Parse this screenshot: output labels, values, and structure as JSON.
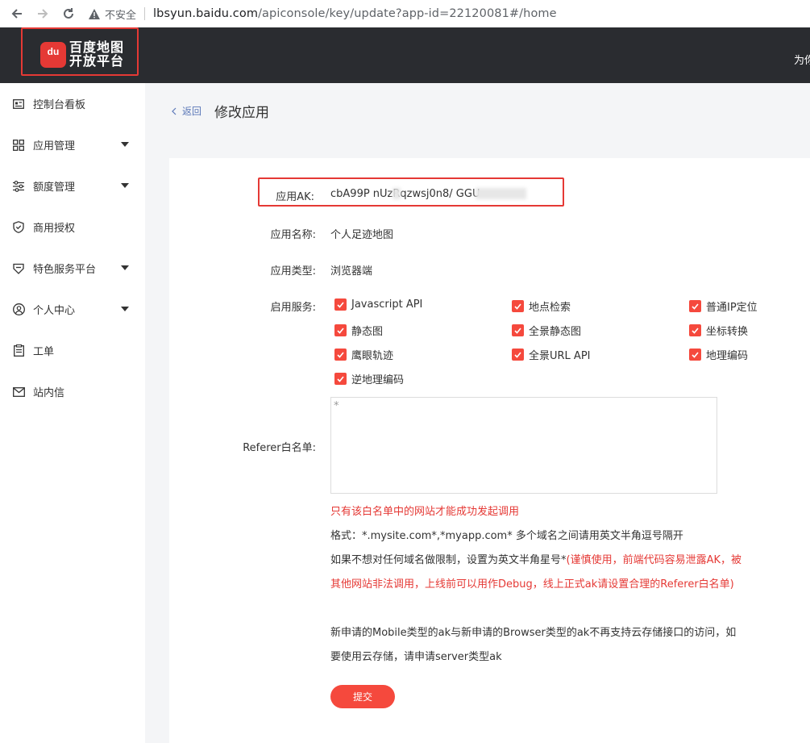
{
  "browser": {
    "insecure_label": "不安全",
    "url_host": "lbsyun.baidu.com",
    "url_path": "/apiconsole/key/update?app-id=22120081#/home"
  },
  "header": {
    "logo_mark": "du",
    "logo_line1": "百度地图",
    "logo_line2": "开放平台",
    "right_text": "为你"
  },
  "sidebar": {
    "items": [
      {
        "label": "控制台看板",
        "icon": "dashboard-icon"
      },
      {
        "label": "应用管理",
        "icon": "grid-icon",
        "expandable": true
      },
      {
        "label": "额度管理",
        "icon": "sliders-icon",
        "expandable": true
      },
      {
        "label": "商用授权",
        "icon": "shield-icon"
      },
      {
        "label": "特色服务平台",
        "icon": "badge-icon",
        "expandable": true
      },
      {
        "label": "个人中心",
        "icon": "user-icon",
        "expandable": true
      },
      {
        "label": "工单",
        "icon": "clipboard-icon"
      },
      {
        "label": "站内信",
        "icon": "mail-icon"
      }
    ]
  },
  "page": {
    "back_label": "返回",
    "title": "修改应用"
  },
  "form": {
    "ak_label": "应用AK:",
    "ak_value": "cbA99P   nUzRqzwsj0n8/          GGU",
    "name_label": "应用名称:",
    "name_value": "个人足迹地图",
    "type_label": "应用类型:",
    "type_value": "浏览器端",
    "services_label": "启用服务:",
    "services": [
      "Javascript API",
      "地点检索",
      "普通IP定位",
      "静态图",
      "全景静态图",
      "坐标转换",
      "鹰眼轨迹",
      "全景URL API",
      "地理编码",
      "逆地理编码"
    ],
    "referer_label": "Referer白名单:",
    "referer_value": "*",
    "note_red": "只有该白名单中的网站才能成功发起调用",
    "note_format": "格式：*.mysite.com*,*myapp.com* 多个域名之间请用英文半角逗号隔开",
    "note_limit_prefix": "如果不想对任何域名做限制，设置为英文半角星号*",
    "note_limit_warning": "(谨慎使用，前端代码容易泄露AK，被其他网站非法调用，上线前可以用作Debug，线上正式ak请设置合理的Referer白名单)",
    "note_mobile": "新申请的Mobile类型的ak与新申请的Browser类型的ak不再支持云存储接口的访问，如要使用云存储，请申请server类型ak",
    "submit_label": "提交"
  }
}
